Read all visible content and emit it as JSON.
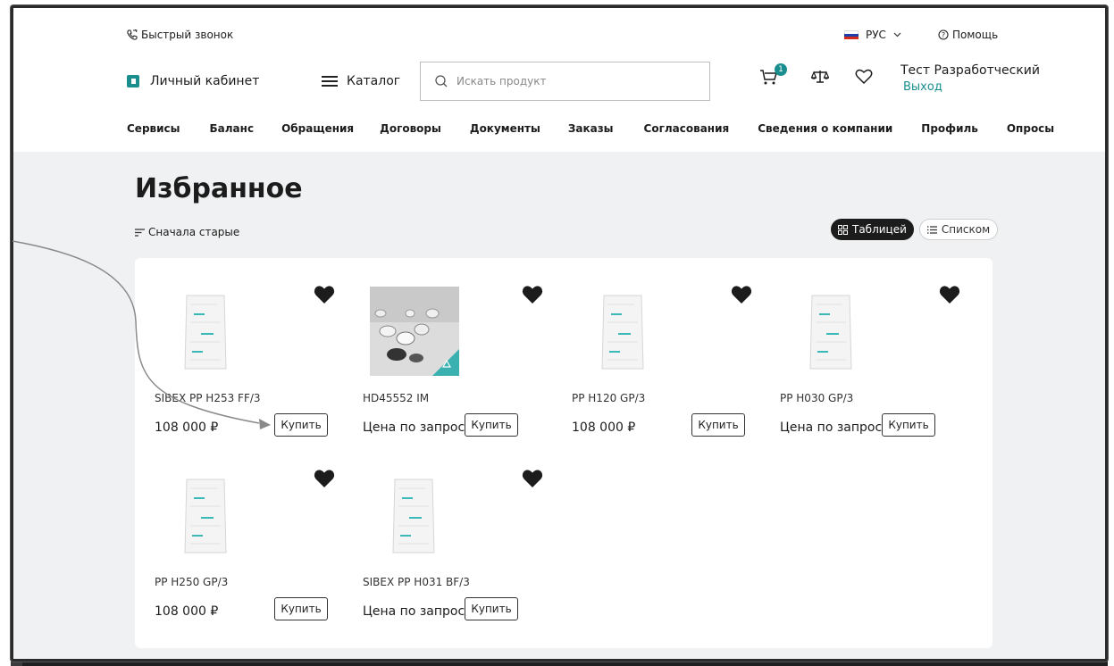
{
  "header": {
    "callback_label": "Быстрый звонок",
    "lang_label": "РУС",
    "help_label": "Помощь",
    "account_label": "Личный кабинет",
    "catalog_label": "Каталог",
    "search_placeholder": "Искать продукт",
    "cart_count": "1",
    "user_name": "Тест Разработческий",
    "logout_label": "Выход",
    "nav": [
      "Сервисы",
      "Баланс",
      "Обращения",
      "Договоры",
      "Документы",
      "Заказы",
      "Согласования",
      "Сведения о компании",
      "Профиль",
      "Опросы"
    ]
  },
  "page": {
    "title": "Избранное",
    "sort_label": "Сначала старые",
    "view_table_label": "Таблицей",
    "view_list_label": "Списком"
  },
  "products": [
    {
      "name": "SIBEX PP H253 FF/3",
      "price": "108 000 ₽",
      "buy_label": "Купить",
      "image": "bag-icon"
    },
    {
      "name": "HD45552 IM",
      "price": "Цена по запросу",
      "buy_label": "Купить",
      "image": "granules-icon"
    },
    {
      "name": "PP H120 GP/3",
      "price": "108 000 ₽",
      "buy_label": "Купить",
      "image": "bag-icon"
    },
    {
      "name": "PP H030 GP/3",
      "price": "Цена по запросу",
      "buy_label": "Купить",
      "image": "bag-icon"
    },
    {
      "name": "PP H250 GP/3",
      "price": "108 000 ₽",
      "buy_label": "Купить",
      "image": "bag-icon"
    },
    {
      "name": "SIBEX PP H031 BF/3",
      "price": "Цена по запросу",
      "buy_label": "Купить",
      "image": "bag-icon"
    }
  ],
  "colors": {
    "accent": "#1a8e8e",
    "page_bg": "#f0f1f2",
    "text": "#1c1c1c"
  }
}
